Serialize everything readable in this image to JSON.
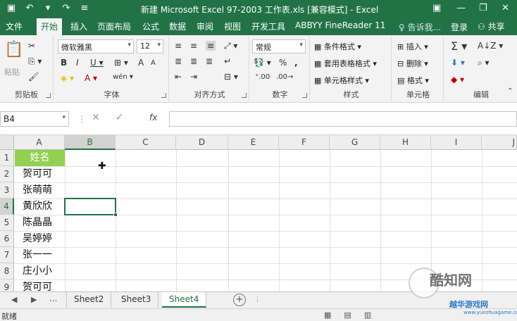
{
  "window": {
    "title": "新建 Microsoft Excel 97-2003 工作表.xls  [兼容模式] - Excel"
  },
  "ribbon_tabs": [
    "文件",
    "开始",
    "插入",
    "页面布局",
    "公式",
    "数据",
    "审阅",
    "视图",
    "开发工具",
    "ABBYY FineReader 11"
  ],
  "active_tab": "开始",
  "tell_me": "告诉我...",
  "login": "登录",
  "share": "共享",
  "ribbon": {
    "clipboard": {
      "label": "剪贴板",
      "paste": "粘贴"
    },
    "font": {
      "label": "字体",
      "name": "微软雅黑",
      "size": "12"
    },
    "alignment": {
      "label": "对齐方式"
    },
    "number": {
      "label": "数字",
      "format": "常规"
    },
    "styles": {
      "label": "样式",
      "conditional": "条件格式",
      "table": "套用表格格式",
      "cell_styles": "单元格样式"
    },
    "cells": {
      "label": "单元格",
      "insert": "插入",
      "delete": "删除",
      "format": "格式"
    },
    "editing": {
      "label": "编辑"
    }
  },
  "formula_bar": {
    "name_box": "B4",
    "fx": "fx",
    "value": ""
  },
  "grid": {
    "columns": [
      "A",
      "B",
      "C",
      "D",
      "E",
      "F",
      "G",
      "H",
      "I",
      "J"
    ],
    "rows": [
      "1",
      "2",
      "3",
      "4",
      "5",
      "6",
      "7",
      "8",
      "9"
    ],
    "selected_cell": "B4",
    "column_a": [
      "姓名",
      "贺可可",
      "张萌萌",
      "黄欣欣",
      "陈晶晶",
      "吴婷婷",
      "张一一",
      "庄小小",
      "贺可可"
    ]
  },
  "sheets": [
    "Sheet2",
    "Sheet3",
    "Sheet4"
  ],
  "active_sheet": "Sheet4",
  "sheet_nav": "...",
  "status": "就绪",
  "watermark": {
    "brand": "酷知网",
    "site": "越华游戏网",
    "url": "www.yuezhuagame.com"
  },
  "colors": {
    "accent": "#217346",
    "header_fill": "#92d050"
  }
}
